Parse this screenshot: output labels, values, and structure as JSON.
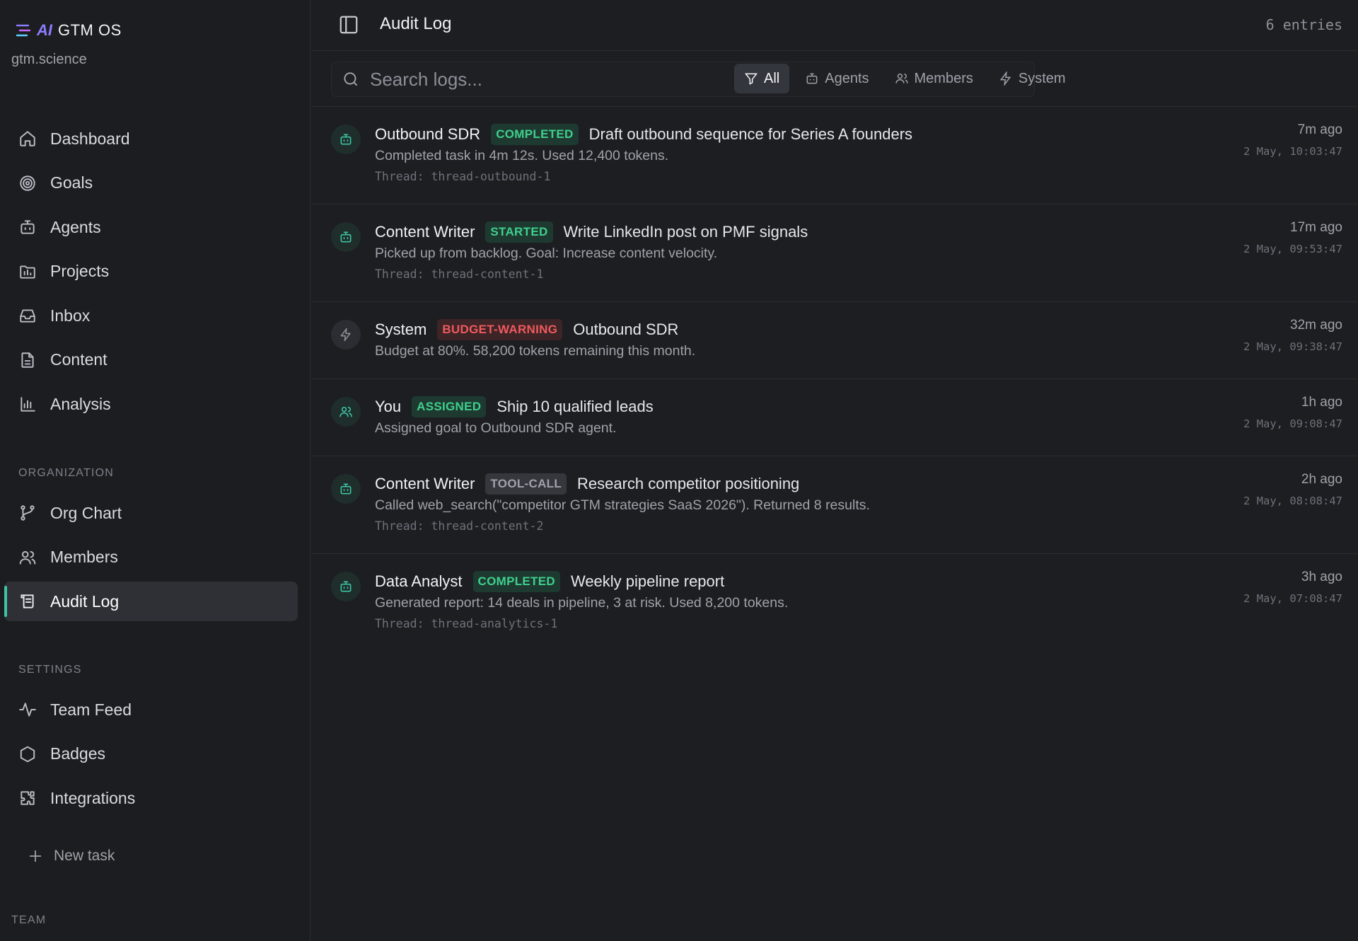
{
  "brand": {
    "ai": "AI",
    "name": "GTM OS",
    "workspace": "gtm.science"
  },
  "sidebar": {
    "main_items": [
      {
        "label": "Dashboard",
        "icon": "home-icon"
      },
      {
        "label": "Goals",
        "icon": "target-icon"
      },
      {
        "label": "Agents",
        "icon": "bot-icon"
      },
      {
        "label": "Projects",
        "icon": "folder-chart-icon"
      },
      {
        "label": "Inbox",
        "icon": "inbox-icon"
      },
      {
        "label": "Content",
        "icon": "file-text-icon"
      },
      {
        "label": "Analysis",
        "icon": "bar-chart-icon"
      }
    ],
    "organization_label": "ORGANIZATION",
    "organization_items": [
      {
        "label": "Org Chart",
        "icon": "git-branch-icon"
      },
      {
        "label": "Members",
        "icon": "users-icon"
      },
      {
        "label": "Audit Log",
        "icon": "scroll-icon",
        "active": true
      }
    ],
    "settings_label": "SETTINGS",
    "settings_items": [
      {
        "label": "Team Feed",
        "icon": "activity-icon"
      },
      {
        "label": "Badges",
        "icon": "hexagon-icon"
      },
      {
        "label": "Integrations",
        "icon": "puzzle-icon"
      }
    ],
    "new_task_label": "New task",
    "team_label": "TEAM"
  },
  "header": {
    "title": "Audit Log",
    "entries": "6 entries"
  },
  "toolbar": {
    "search_placeholder": "Search logs...",
    "filters": [
      {
        "label": "All",
        "icon": "filter-icon",
        "active": true
      },
      {
        "label": "Agents",
        "icon": "bot-icon"
      },
      {
        "label": "Members",
        "icon": "users-icon"
      },
      {
        "label": "System",
        "icon": "zap-icon"
      }
    ]
  },
  "logs": [
    {
      "actor": "Outbound SDR",
      "kind": "agent",
      "badge": "COMPLETED",
      "badge_color": "green",
      "target": "Draft outbound sequence for Series A founders",
      "desc": "Completed task in 4m 12s. Used 12,400 tokens.",
      "thread": "Thread: thread-outbound-1",
      "rel": "7m ago",
      "abs": "2 May, 10:03:47"
    },
    {
      "actor": "Content Writer",
      "kind": "agent",
      "badge": "STARTED",
      "badge_color": "green",
      "target": "Write LinkedIn post on PMF signals",
      "desc": "Picked up from backlog. Goal: Increase content velocity.",
      "thread": "Thread: thread-content-1",
      "rel": "17m ago",
      "abs": "2 May, 09:53:47"
    },
    {
      "actor": "System",
      "kind": "system",
      "badge": "BUDGET-WARNING",
      "badge_color": "red",
      "target": "Outbound SDR",
      "desc": "Budget at 80%. 58,200 tokens remaining this month.",
      "thread": "",
      "rel": "32m ago",
      "abs": "2 May, 09:38:47"
    },
    {
      "actor": "You",
      "kind": "member",
      "badge": "ASSIGNED",
      "badge_color": "green",
      "target": "Ship 10 qualified leads",
      "desc": "Assigned goal to Outbound SDR agent.",
      "thread": "",
      "rel": "1h ago",
      "abs": "2 May, 09:08:47"
    },
    {
      "actor": "Content Writer",
      "kind": "agent",
      "badge": "TOOL-CALL",
      "badge_color": "gray",
      "target": "Research competitor positioning",
      "desc": "Called web_search(\"competitor GTM strategies SaaS 2026\"). Returned 8 results.",
      "thread": "Thread: thread-content-2",
      "rel": "2h ago",
      "abs": "2 May, 08:08:47"
    },
    {
      "actor": "Data Analyst",
      "kind": "agent",
      "badge": "COMPLETED",
      "badge_color": "green",
      "target": "Weekly pipeline report",
      "desc": "Generated report: 14 deals in pipeline, 3 at risk. Used 8,200 tokens.",
      "thread": "Thread: thread-analytics-1",
      "rel": "3h ago",
      "abs": "2 May, 07:08:47"
    }
  ]
}
